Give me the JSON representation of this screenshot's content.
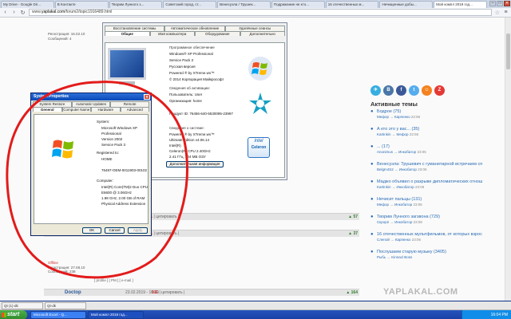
{
  "browser": {
    "tabs": [
      {
        "label": "My Drive - Google Dri..."
      },
      {
        "label": "В Контакте"
      },
      {
        "label": "Творим Лунного з..."
      },
      {
        "label": "Советский город, ст..."
      },
      {
        "label": "Венесуэла / Трушек..."
      },
      {
        "label": "Подражание не кто..."
      },
      {
        "label": "16 отечественных м..."
      },
      {
        "label": "Нечищенные добы..."
      },
      {
        "label": "Мой компл 2019 год..."
      }
    ],
    "url_prefix": "www.",
    "url_domain": "yaplakal.com",
    "url_path": "/forum2/topic1916489.html"
  },
  "post1": {
    "meta1": "Регистрация: 16.02.10",
    "meta2": "Сообщений: 4"
  },
  "post2": {
    "status": "Offline",
    "meta1": "Регистрация: 27.08.10",
    "meta2": "Сообщений: 238",
    "links": "[ profile ] [ PM ] [ e-mail ]"
  },
  "strip1": {
    "num": "911",
    "text": "| цитировать |",
    "vote": "57"
  },
  "strip2": {
    "num": "911",
    "text": "| цитировать |",
    "vote": "37"
  },
  "strip3": {
    "author": "Doctop",
    "date": "23.02.2019 - 16:49",
    "num": "911",
    "text": "| цитировать |",
    "vote": "164"
  },
  "dlg_big": {
    "tabs": [
      "Восстановление системы",
      "Автоматическое обновление",
      "Удалённые сеансы",
      "Общие",
      "Имя компьютера",
      "Оборудование",
      "Дополнительно"
    ],
    "section_os": "Программное обеспечение",
    "os_lines": [
      "Windows® XP Professional",
      "Service Pack 3",
      "Русская версия",
      "Powered ® by XTreme.ws™",
      "© 2014 Корпорация Майкрософт"
    ],
    "section_reg": "Сведения об активации:",
    "reg_lines": [
      "Пользователь:  User",
      "Организация:  home",
      "",
      "Продукт ID:   76456-640-5530095-23997"
    ],
    "section_sys": "Сведения о системе:",
    "sys_lines": [
      "Powered ® by XTreme.ws™",
      "Ultimate Edition v4.06.14",
      "Intel(R)",
      "Celeron(R) CPU 2.40GHz",
      "2.41 ГГц, 704 МБ ОЗУ"
    ],
    "support_btn": "Дополнительная информация",
    "intel_brand": "intel",
    "intel_product": "Celeron"
  },
  "dlg_small": {
    "title": "System Properties",
    "tabs": [
      "System Restore",
      "Automatic Updates",
      "Remote",
      "General",
      "Computer Name",
      "Hardware",
      "Advanced"
    ],
    "system_label": "System:",
    "system_lines": [
      "Microsoft Windows XP",
      "Professional",
      "Version 2002",
      "Service Pack 3"
    ],
    "reg_label": "Registered to:",
    "reg_lines": [
      "HOME",
      "",
      "76487-OEM-0011903-00102"
    ],
    "comp_label": "Computer:",
    "comp_lines": [
      "Intel(R) Core(TM)2 Duo CPU",
      "E6600  @ 3.06GHz",
      "1.98 GHz, 2.00 GB of RAM",
      "Physical Address Extension"
    ],
    "ok": "OK",
    "cancel": "Cancel",
    "apply": "Apply"
  },
  "sidebar": {
    "social": [
      {
        "label": "✈",
        "color": "#37aee2"
      },
      {
        "label": "B",
        "color": "#4a76a8"
      },
      {
        "label": "f",
        "color": "#3b5998"
      },
      {
        "label": "t",
        "color": "#55acee"
      },
      {
        "label": "☺",
        "color": "#f58220"
      },
      {
        "label": "Z",
        "color": "#e53935"
      }
    ],
    "title": "Активные темы",
    "topics": [
      {
        "title": "Бодрое (75)",
        "author": "Мефор",
        "last": "Карпенко",
        "time": "22:56"
      },
      {
        "title": "А кто это у вас... (35)",
        "author": "Kartinkin",
        "last": "Мефор",
        "time": "22:56"
      },
      {
        "title": "... (17)",
        "author": "Anonimus",
        "last": "Инкобатор",
        "time": "23:05"
      },
      {
        "title": "Венесуэла: Трушевич с гуманитарной встречаем спецоточника (45)",
        "author": "BelgIn4S2",
        "last": "Инкобатор",
        "time": "23:06"
      },
      {
        "title": "Маджо объявил о разрыве дипломатических отношений с Колумбией (1)",
        "author": "Kartinkin",
        "last": "Инкобатор",
        "time": "23:06"
      },
      {
        "title": "Нечисит пальцы (131)",
        "author": "Мефор",
        "last": "Инкобатор",
        "time": "23:06"
      },
      {
        "title": "Творим Лунного загзвона (729)",
        "author": "Скрорп",
        "last": "Инкобатор",
        "time": "23:06"
      },
      {
        "title": "16 отечественных мультфильмов, от которых взрослым получит больше (292)",
        "author": "Слепой",
        "last": "Карпенко",
        "time": "23:06"
      },
      {
        "title": "Послушаем старую музыку (3405)",
        "author": "Рыбь",
        "last": "Kinnacl Boss",
        "time": ""
      }
    ],
    "watermark": "YAPLAKAL.COM"
  },
  "quickbar": [
    {
      "label": "Qt (1)-dk"
    },
    {
      "label": "Qt-dk"
    }
  ],
  "taskbar": {
    "start": "start",
    "tasks": [
      {
        "label": "Microsoft Excel - Q..."
      },
      {
        "label": "Мой компл 2019 год..."
      }
    ],
    "clock": "16:04 PM"
  }
}
